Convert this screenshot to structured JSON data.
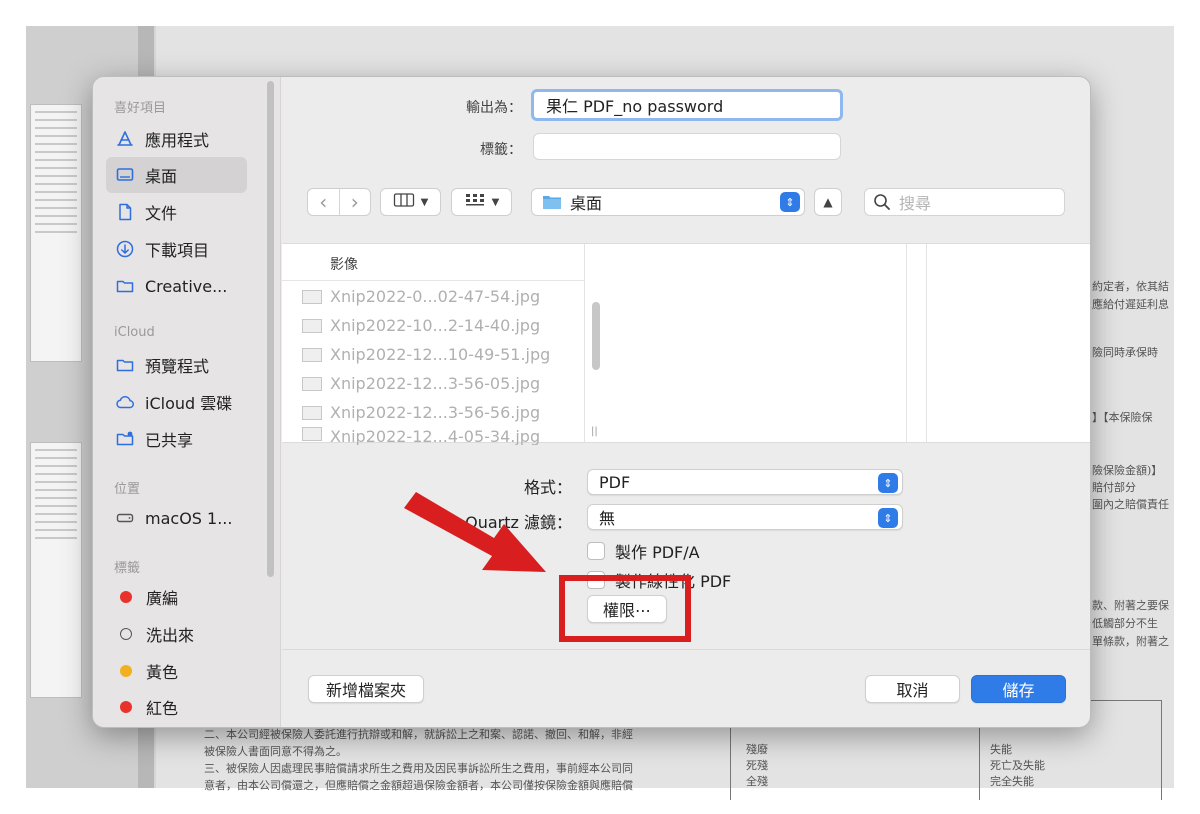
{
  "background": {
    "right_text": [
      "約定者，依其結",
      "應給付遲延利息",
      "險同時承保時",
      "】【本保險保",
      "險保險金額)】",
      "賠付部分",
      "圍內之賠償責任",
      "款、附著之要保",
      "低觸部分不生",
      "單條款，附著之"
    ],
    "bottom_text": [
      "二、本公司經被保險人委託進行抗辯或和解，就訴訟上之和案、認諾、撤回、和解，非經",
      "被保險人書面同意不得為之。",
      "三、被保險人因處理民事賠償請求所生之費用及因民事訴訟所生之費用，事前經本公司同",
      "意者，由本公司償還之，但應賠償之金額超過保險金額者，本公司僅按保險金額與應賠償"
    ],
    "table_col1": [
      "殘廢",
      "死殘",
      "全殘"
    ],
    "table_col2": [
      "失能",
      "死亡及失能",
      "完全失能"
    ]
  },
  "sidebar": {
    "favorites_header": "喜好項目",
    "favorites": [
      {
        "label": "應用程式",
        "icon": "applications-icon"
      },
      {
        "label": "桌面",
        "icon": "desktop-icon",
        "selected": true
      },
      {
        "label": "文件",
        "icon": "document-icon"
      },
      {
        "label": "下載項目",
        "icon": "download-icon"
      },
      {
        "label": "Creative...",
        "icon": "folder-icon"
      }
    ],
    "icloud_header": "iCloud",
    "icloud": [
      {
        "label": "預覽程式",
        "icon": "folder-icon"
      },
      {
        "label": "iCloud 雲碟",
        "icon": "cloud-icon"
      },
      {
        "label": "已共享",
        "icon": "shared-folder-icon"
      }
    ],
    "locations_header": "位置",
    "locations": [
      {
        "label": "macOS 1...",
        "icon": "disk-icon"
      }
    ],
    "tags_header": "標籤",
    "tags": [
      {
        "label": "廣編",
        "color": "#e8322c"
      },
      {
        "label": "洗出來",
        "color": ""
      },
      {
        "label": "黃色",
        "color": "#f2b01e"
      },
      {
        "label": "紅色",
        "color": "#e8322c"
      }
    ]
  },
  "save": {
    "export_as_label": "輸出為：",
    "export_as_value": "果仁 PDF_no password",
    "tags_label": "標籤：",
    "tags_value": ""
  },
  "toolbar": {
    "back": "‹",
    "forward": "›",
    "location": "桌面",
    "search_placeholder": "搜尋"
  },
  "browser": {
    "column_header": "影像",
    "files": [
      "Xnip2022-0...02-47-54.jpg",
      "Xnip2022-10...2-14-40.jpg",
      "Xnip2022-12...10-49-51.jpg",
      "Xnip2022-12...3-56-05.jpg",
      "Xnip2022-12...3-56-56.jpg",
      "Xnip2022-12...4-05-34.jpg"
    ]
  },
  "options": {
    "format_label": "格式：",
    "format_value": "PDF",
    "quartz_label": "Quartz 濾鏡：",
    "quartz_value": "無",
    "pdfa_label": "製作 PDF/A",
    "linearized_label": "製作線性化 PDF",
    "permissions_button": "權限⋯"
  },
  "footer": {
    "new_folder": "新增檔案夾",
    "cancel": "取消",
    "save": "儲存"
  },
  "colors": {
    "accent": "#2f7ce8",
    "annotation": "#d81e1e"
  }
}
